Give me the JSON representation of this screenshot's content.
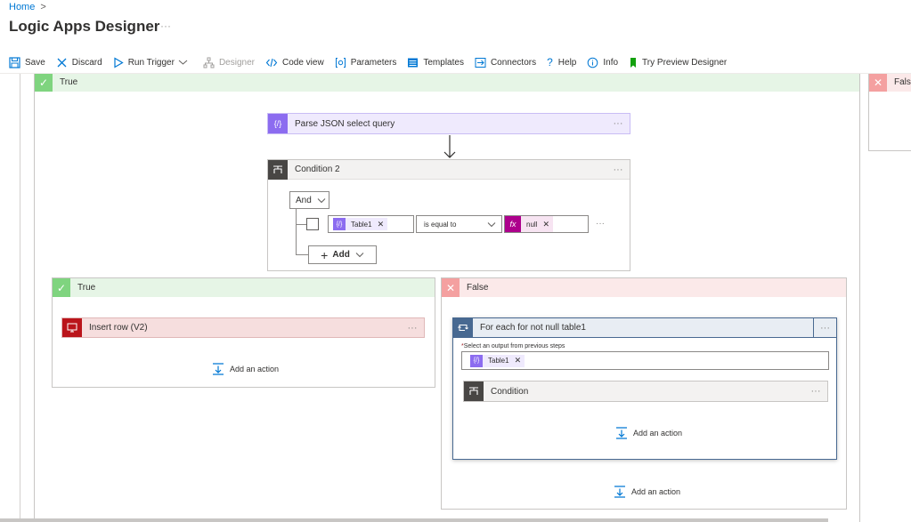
{
  "breadcrumb": {
    "home": "Home",
    "sep": ">"
  },
  "page": {
    "title": "Logic Apps Designer",
    "more": "···"
  },
  "toolbar": {
    "save": "Save",
    "discard": "Discard",
    "run_trigger": "Run Trigger",
    "designer": "Designer",
    "code_view": "Code view",
    "parameters": "Parameters",
    "templates": "Templates",
    "connectors": "Connectors",
    "help": "Help",
    "info": "Info",
    "try_preview": "Try Preview Designer"
  },
  "outer_true": {
    "label": "True",
    "icon": "check-icon"
  },
  "outer_false": {
    "label": "False",
    "icon": "close-icon"
  },
  "parse_json": {
    "title": "Parse JSON select query",
    "more": "···"
  },
  "condition2": {
    "title": "Condition 2",
    "more": "···",
    "operator": "And",
    "left_token": "Table1",
    "comparison": "is equal to",
    "right_token": "null",
    "row_more": "···",
    "add_label": "Add"
  },
  "inner_true": {
    "label": "True",
    "action_title": "Insert row (V2)",
    "action_more": "···",
    "add_action": "Add an action"
  },
  "inner_false": {
    "label": "False",
    "foreach_title": "For each for not null table1",
    "foreach_more": "···",
    "select_label_star": "*",
    "select_label": "Select an output from previous steps",
    "select_token": "Table1",
    "nested_condition": "Condition",
    "nested_more": "···",
    "foreach_add_action": "Add an action",
    "add_action": "Add an action"
  },
  "colors": {
    "accent": "#0078d4",
    "variable_purple": "#8c6cf0",
    "condition_gray": "#484644",
    "sql_red": "#ba141a",
    "expression_magenta": "#ad008c",
    "foreach_blue": "#486991",
    "true_green": "#7fd47f",
    "false_red": "#f4a0a0"
  }
}
